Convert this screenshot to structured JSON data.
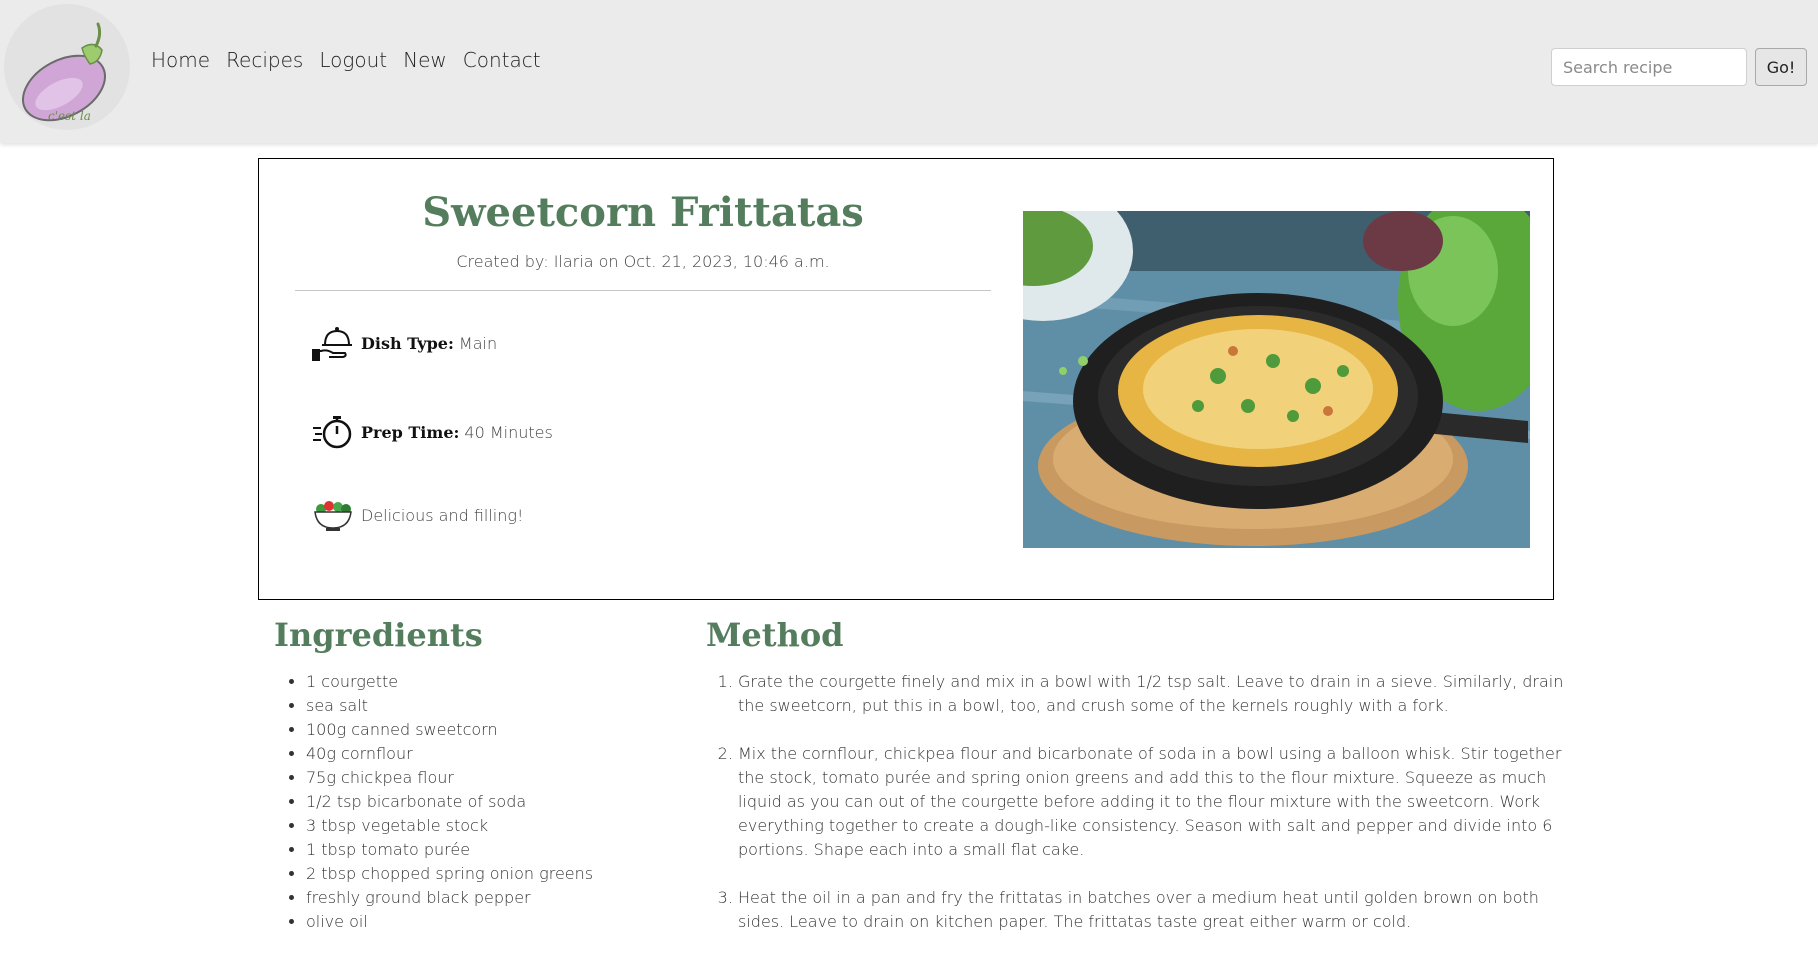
{
  "logo": {
    "icon": "eggplant-logo-icon",
    "text": "c'est la"
  },
  "nav": {
    "items": [
      {
        "label": "Home"
      },
      {
        "label": "Recipes"
      },
      {
        "label": "Logout"
      },
      {
        "label": "New"
      },
      {
        "label": "Contact"
      }
    ]
  },
  "search": {
    "placeholder": "Search recipe",
    "value": "",
    "button_label": "Go!"
  },
  "recipe": {
    "title": "Sweetcorn Frittatas",
    "created_by": "Created by: Ilaria on Oct. 21, 2023, 10:46 a.m.",
    "dish_type_label": "Dish Type:",
    "dish_type_value": "Main",
    "dish_type_icon": "serving-cloche-icon",
    "prep_time_label": "Prep Time:",
    "prep_time_value": "40 Minutes",
    "prep_time_icon": "stopwatch-icon",
    "description": "Delicious and filling!",
    "description_icon": "salad-bowl-icon",
    "photo": "frittata-in-skillet-photo"
  },
  "ingredients": {
    "title": "Ingredients",
    "items": [
      "1 courgette",
      "sea salt",
      "100g canned sweetcorn",
      "40g cornflour",
      "75g chickpea flour",
      "1/2 tsp bicarbonate of soda",
      "3 tbsp vegetable stock",
      "1 tbsp tomato purée",
      "2 tbsp chopped spring onion greens",
      "freshly ground black pepper",
      "olive oil"
    ]
  },
  "method": {
    "title": "Method",
    "steps": [
      "Grate the courgette finely and mix in a bowl with 1/2 tsp salt. Leave to drain in a sieve. Similarly, drain the sweetcorn, put this in a bowl, too, and crush some of the kernels roughly with a fork.",
      "Mix the cornflour, chickpea flour and bicarbonate of soda in a bowl using a balloon whisk. Stir together the stock, tomato purée and spring onion greens and add this to the flour mixture. Squeeze as much liquid as you can out of the courgette before adding it to the flour mixture with the sweetcorn. Work everything together to create a dough-like consistency. Season with salt and pepper and divide into 6 portions. Shape each into a small flat cake.",
      "Heat the oil in a pan and fry the frittatas in batches over a medium heat until golden brown on both sides. Leave to drain on kitchen paper. The frittatas taste great either warm or cold."
    ]
  },
  "colors": {
    "accent_green": "#537d5d",
    "navbar_bg": "#ebebeb"
  }
}
